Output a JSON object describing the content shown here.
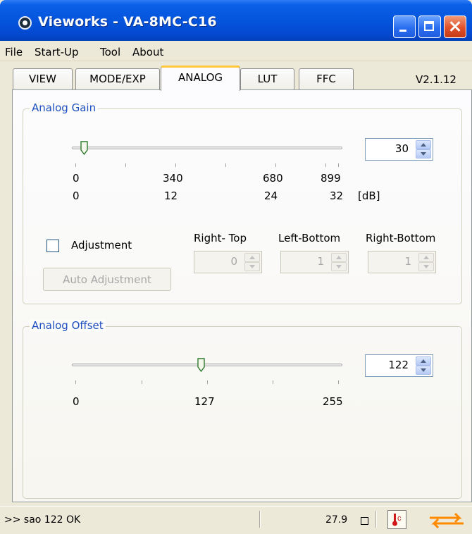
{
  "window": {
    "title": "Vieworks - VA-8MC-C16"
  },
  "menu": [
    "File",
    "Start-Up",
    "Tool",
    "About"
  ],
  "tabs": [
    "VIEW",
    "MODE/EXP",
    "ANALOG",
    "LUT",
    "FFC"
  ],
  "active_tab": "ANALOG",
  "version": "V2.1.12",
  "analog_gain": {
    "title": "Analog Gain",
    "value": "30",
    "range": [
      0,
      899
    ],
    "ticks_raw": [
      "0",
      "340",
      "680",
      "899"
    ],
    "ticks_db": [
      "0",
      "12",
      "24",
      "32"
    ],
    "unit": "[dB]",
    "adjustment_label": "Adjustment",
    "adjustment_checked": false,
    "auto_adjustment_label": "Auto Adjustment",
    "right_top": {
      "label": "Right- Top",
      "value": "0"
    },
    "left_bottom": {
      "label": "Left-Bottom",
      "value": "1"
    },
    "right_bottom": {
      "label": "Right-Bottom",
      "value": "1"
    }
  },
  "analog_offset": {
    "title": "Analog Offset",
    "value": "122",
    "range": [
      0,
      255
    ],
    "ticks": [
      "0",
      "127",
      "255"
    ]
  },
  "status": {
    "message": ">> sao 122  OK",
    "temperature": "27.9"
  },
  "colors": {
    "accent_orange": "#ff8a00",
    "group_title": "#1f4fbf",
    "titlebar": "#0555dc"
  }
}
